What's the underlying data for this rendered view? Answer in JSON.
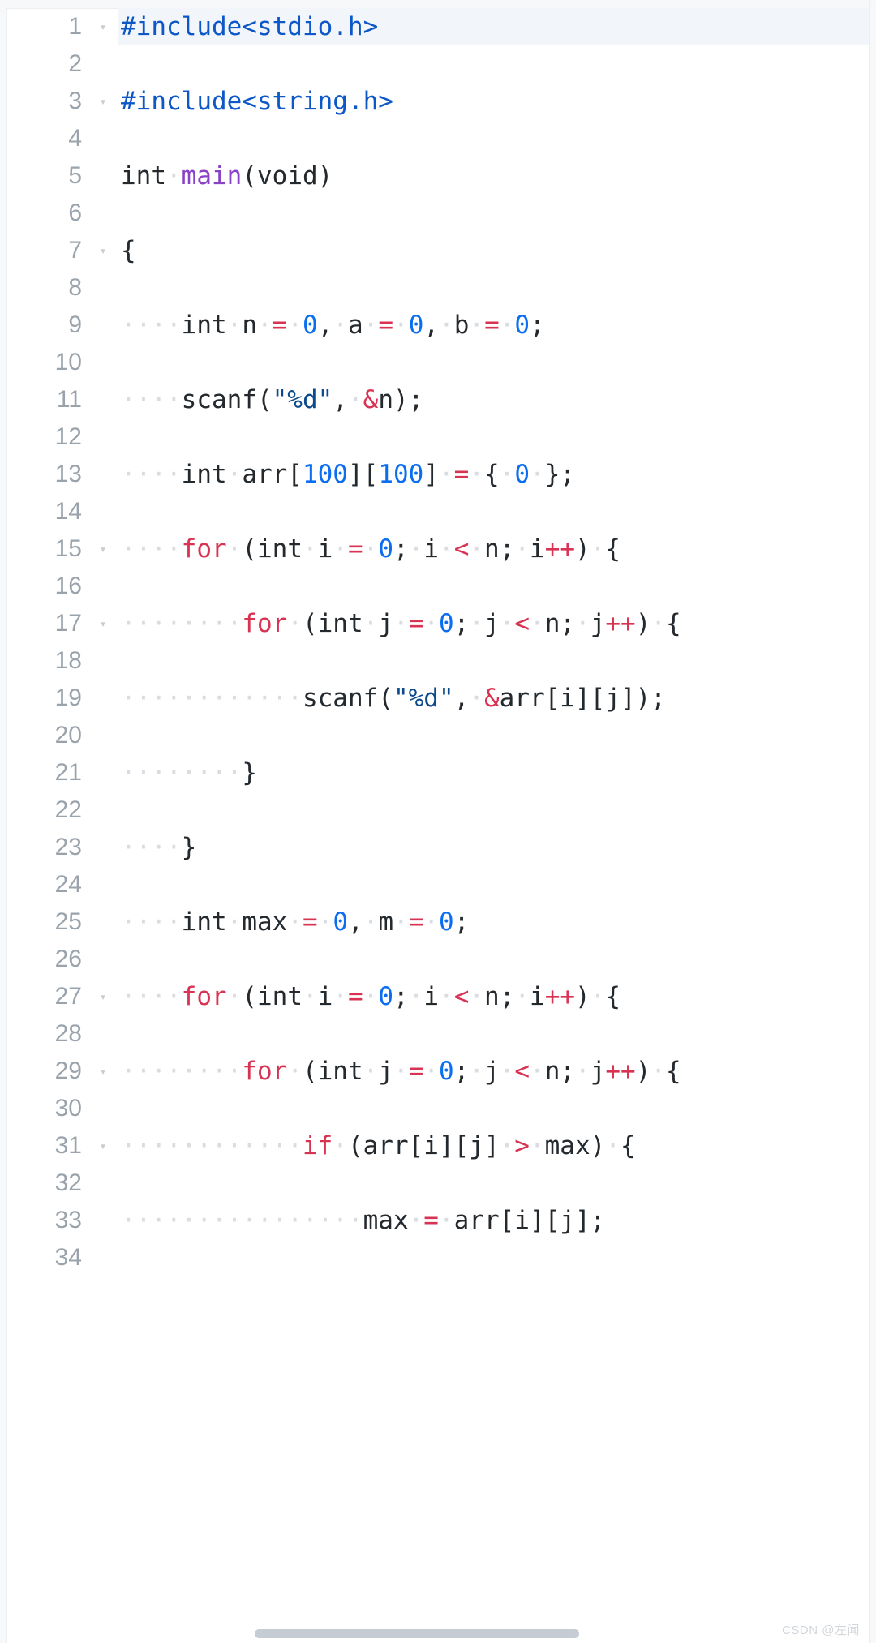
{
  "editor": {
    "language": "c",
    "indent_dot": "·",
    "fold_arrow": "▾",
    "colors": {
      "background": "#ffffff",
      "gutter_text": "#9aa3ab",
      "active_line_bg": "#f2f6fb",
      "preprocessor": "#0d58c6",
      "keyword": "#d93353",
      "function": "#8a42c8",
      "number": "#0b6ef0",
      "string": "#0d4a8c",
      "operator": "#d93353",
      "plain": "#24292e",
      "whitespace_dot": "#d9dde1",
      "scrollbar": "#c6ccd3"
    },
    "lines": [
      {
        "number": "1",
        "foldable": true,
        "highlight": true,
        "tokens": [
          {
            "t": "#include<stdio.h>",
            "c": "pre"
          }
        ]
      },
      {
        "number": "2",
        "foldable": false,
        "highlight": false,
        "tokens": []
      },
      {
        "number": "3",
        "foldable": true,
        "highlight": false,
        "tokens": [
          {
            "t": "#include<string.h>",
            "c": "pre"
          }
        ]
      },
      {
        "number": "4",
        "foldable": false,
        "highlight": false,
        "tokens": []
      },
      {
        "number": "5",
        "foldable": false,
        "highlight": false,
        "tokens": [
          {
            "t": "int",
            "c": "plain"
          },
          {
            "t": "·",
            "c": "ws"
          },
          {
            "t": "main",
            "c": "fn"
          },
          {
            "t": "(void)",
            "c": "plain"
          }
        ]
      },
      {
        "number": "6",
        "foldable": false,
        "highlight": false,
        "tokens": []
      },
      {
        "number": "7",
        "foldable": true,
        "highlight": false,
        "tokens": [
          {
            "t": "{",
            "c": "plain"
          }
        ]
      },
      {
        "number": "8",
        "foldable": false,
        "highlight": false,
        "tokens": []
      },
      {
        "number": "9",
        "foldable": false,
        "highlight": false,
        "tokens": [
          {
            "t": "····",
            "c": "ws"
          },
          {
            "t": "int",
            "c": "plain"
          },
          {
            "t": "·",
            "c": "ws"
          },
          {
            "t": "n",
            "c": "plain"
          },
          {
            "t": "·",
            "c": "ws"
          },
          {
            "t": "=",
            "c": "op"
          },
          {
            "t": "·",
            "c": "ws"
          },
          {
            "t": "0",
            "c": "num"
          },
          {
            "t": ",",
            "c": "plain"
          },
          {
            "t": "·",
            "c": "ws"
          },
          {
            "t": "a",
            "c": "plain"
          },
          {
            "t": "·",
            "c": "ws"
          },
          {
            "t": "=",
            "c": "op"
          },
          {
            "t": "·",
            "c": "ws"
          },
          {
            "t": "0",
            "c": "num"
          },
          {
            "t": ",",
            "c": "plain"
          },
          {
            "t": "·",
            "c": "ws"
          },
          {
            "t": "b",
            "c": "plain"
          },
          {
            "t": "·",
            "c": "ws"
          },
          {
            "t": "=",
            "c": "op"
          },
          {
            "t": "·",
            "c": "ws"
          },
          {
            "t": "0",
            "c": "num"
          },
          {
            "t": ";",
            "c": "plain"
          }
        ]
      },
      {
        "number": "10",
        "foldable": false,
        "highlight": false,
        "tokens": []
      },
      {
        "number": "11",
        "foldable": false,
        "highlight": false,
        "tokens": [
          {
            "t": "····",
            "c": "ws"
          },
          {
            "t": "scanf(",
            "c": "plain"
          },
          {
            "t": "\"%d\"",
            "c": "str"
          },
          {
            "t": ",",
            "c": "plain"
          },
          {
            "t": "·",
            "c": "ws"
          },
          {
            "t": "&",
            "c": "op"
          },
          {
            "t": "n);",
            "c": "plain"
          }
        ]
      },
      {
        "number": "12",
        "foldable": false,
        "highlight": false,
        "tokens": []
      },
      {
        "number": "13",
        "foldable": false,
        "highlight": false,
        "tokens": [
          {
            "t": "····",
            "c": "ws"
          },
          {
            "t": "int",
            "c": "plain"
          },
          {
            "t": "·",
            "c": "ws"
          },
          {
            "t": "arr[",
            "c": "plain"
          },
          {
            "t": "100",
            "c": "num"
          },
          {
            "t": "][",
            "c": "plain"
          },
          {
            "t": "100",
            "c": "num"
          },
          {
            "t": "]",
            "c": "plain"
          },
          {
            "t": "·",
            "c": "ws"
          },
          {
            "t": "=",
            "c": "op"
          },
          {
            "t": "·",
            "c": "ws"
          },
          {
            "t": "{",
            "c": "plain"
          },
          {
            "t": "·",
            "c": "ws"
          },
          {
            "t": "0",
            "c": "num"
          },
          {
            "t": "·",
            "c": "ws"
          },
          {
            "t": "};",
            "c": "plain"
          }
        ]
      },
      {
        "number": "14",
        "foldable": false,
        "highlight": false,
        "tokens": []
      },
      {
        "number": "15",
        "foldable": true,
        "highlight": false,
        "tokens": [
          {
            "t": "····",
            "c": "ws"
          },
          {
            "t": "for",
            "c": "kw"
          },
          {
            "t": "·",
            "c": "ws"
          },
          {
            "t": "(int",
            "c": "plain"
          },
          {
            "t": "·",
            "c": "ws"
          },
          {
            "t": "i",
            "c": "plain"
          },
          {
            "t": "·",
            "c": "ws"
          },
          {
            "t": "=",
            "c": "op"
          },
          {
            "t": "·",
            "c": "ws"
          },
          {
            "t": "0",
            "c": "num"
          },
          {
            "t": ";",
            "c": "plain"
          },
          {
            "t": "·",
            "c": "ws"
          },
          {
            "t": "i",
            "c": "plain"
          },
          {
            "t": "·",
            "c": "ws"
          },
          {
            "t": "<",
            "c": "op"
          },
          {
            "t": "·",
            "c": "ws"
          },
          {
            "t": "n;",
            "c": "plain"
          },
          {
            "t": "·",
            "c": "ws"
          },
          {
            "t": "i",
            "c": "plain"
          },
          {
            "t": "++",
            "c": "op"
          },
          {
            "t": ")",
            "c": "plain"
          },
          {
            "t": "·",
            "c": "ws"
          },
          {
            "t": "{",
            "c": "plain"
          }
        ]
      },
      {
        "number": "16",
        "foldable": false,
        "highlight": false,
        "tokens": []
      },
      {
        "number": "17",
        "foldable": true,
        "highlight": false,
        "tokens": [
          {
            "t": "········",
            "c": "ws"
          },
          {
            "t": "for",
            "c": "kw"
          },
          {
            "t": "·",
            "c": "ws"
          },
          {
            "t": "(int",
            "c": "plain"
          },
          {
            "t": "·",
            "c": "ws"
          },
          {
            "t": "j",
            "c": "plain"
          },
          {
            "t": "·",
            "c": "ws"
          },
          {
            "t": "=",
            "c": "op"
          },
          {
            "t": "·",
            "c": "ws"
          },
          {
            "t": "0",
            "c": "num"
          },
          {
            "t": ";",
            "c": "plain"
          },
          {
            "t": "·",
            "c": "ws"
          },
          {
            "t": "j",
            "c": "plain"
          },
          {
            "t": "·",
            "c": "ws"
          },
          {
            "t": "<",
            "c": "op"
          },
          {
            "t": "·",
            "c": "ws"
          },
          {
            "t": "n;",
            "c": "plain"
          },
          {
            "t": "·",
            "c": "ws"
          },
          {
            "t": "j",
            "c": "plain"
          },
          {
            "t": "++",
            "c": "op"
          },
          {
            "t": ")",
            "c": "plain"
          },
          {
            "t": "·",
            "c": "ws"
          },
          {
            "t": "{",
            "c": "plain"
          }
        ]
      },
      {
        "number": "18",
        "foldable": false,
        "highlight": false,
        "tokens": []
      },
      {
        "number": "19",
        "foldable": false,
        "highlight": false,
        "tokens": [
          {
            "t": "············",
            "c": "ws"
          },
          {
            "t": "scanf(",
            "c": "plain"
          },
          {
            "t": "\"%d\"",
            "c": "str"
          },
          {
            "t": ",",
            "c": "plain"
          },
          {
            "t": "·",
            "c": "ws"
          },
          {
            "t": "&",
            "c": "op"
          },
          {
            "t": "arr[i][j]);",
            "c": "plain"
          }
        ]
      },
      {
        "number": "20",
        "foldable": false,
        "highlight": false,
        "tokens": []
      },
      {
        "number": "21",
        "foldable": false,
        "highlight": false,
        "tokens": [
          {
            "t": "········",
            "c": "ws"
          },
          {
            "t": "}",
            "c": "plain"
          }
        ]
      },
      {
        "number": "22",
        "foldable": false,
        "highlight": false,
        "tokens": []
      },
      {
        "number": "23",
        "foldable": false,
        "highlight": false,
        "tokens": [
          {
            "t": "····",
            "c": "ws"
          },
          {
            "t": "}",
            "c": "plain"
          }
        ]
      },
      {
        "number": "24",
        "foldable": false,
        "highlight": false,
        "tokens": []
      },
      {
        "number": "25",
        "foldable": false,
        "highlight": false,
        "tokens": [
          {
            "t": "····",
            "c": "ws"
          },
          {
            "t": "int",
            "c": "plain"
          },
          {
            "t": "·",
            "c": "ws"
          },
          {
            "t": "max",
            "c": "plain"
          },
          {
            "t": "·",
            "c": "ws"
          },
          {
            "t": "=",
            "c": "op"
          },
          {
            "t": "·",
            "c": "ws"
          },
          {
            "t": "0",
            "c": "num"
          },
          {
            "t": ",",
            "c": "plain"
          },
          {
            "t": "·",
            "c": "ws"
          },
          {
            "t": "m",
            "c": "plain"
          },
          {
            "t": "·",
            "c": "ws"
          },
          {
            "t": "=",
            "c": "op"
          },
          {
            "t": "·",
            "c": "ws"
          },
          {
            "t": "0",
            "c": "num"
          },
          {
            "t": ";",
            "c": "plain"
          }
        ]
      },
      {
        "number": "26",
        "foldable": false,
        "highlight": false,
        "tokens": []
      },
      {
        "number": "27",
        "foldable": true,
        "highlight": false,
        "tokens": [
          {
            "t": "····",
            "c": "ws"
          },
          {
            "t": "for",
            "c": "kw"
          },
          {
            "t": "·",
            "c": "ws"
          },
          {
            "t": "(int",
            "c": "plain"
          },
          {
            "t": "·",
            "c": "ws"
          },
          {
            "t": "i",
            "c": "plain"
          },
          {
            "t": "·",
            "c": "ws"
          },
          {
            "t": "=",
            "c": "op"
          },
          {
            "t": "·",
            "c": "ws"
          },
          {
            "t": "0",
            "c": "num"
          },
          {
            "t": ";",
            "c": "plain"
          },
          {
            "t": "·",
            "c": "ws"
          },
          {
            "t": "i",
            "c": "plain"
          },
          {
            "t": "·",
            "c": "ws"
          },
          {
            "t": "<",
            "c": "op"
          },
          {
            "t": "·",
            "c": "ws"
          },
          {
            "t": "n;",
            "c": "plain"
          },
          {
            "t": "·",
            "c": "ws"
          },
          {
            "t": "i",
            "c": "plain"
          },
          {
            "t": "++",
            "c": "op"
          },
          {
            "t": ")",
            "c": "plain"
          },
          {
            "t": "·",
            "c": "ws"
          },
          {
            "t": "{",
            "c": "plain"
          }
        ]
      },
      {
        "number": "28",
        "foldable": false,
        "highlight": false,
        "tokens": []
      },
      {
        "number": "29",
        "foldable": true,
        "highlight": false,
        "tokens": [
          {
            "t": "········",
            "c": "ws"
          },
          {
            "t": "for",
            "c": "kw"
          },
          {
            "t": "·",
            "c": "ws"
          },
          {
            "t": "(int",
            "c": "plain"
          },
          {
            "t": "·",
            "c": "ws"
          },
          {
            "t": "j",
            "c": "plain"
          },
          {
            "t": "·",
            "c": "ws"
          },
          {
            "t": "=",
            "c": "op"
          },
          {
            "t": "·",
            "c": "ws"
          },
          {
            "t": "0",
            "c": "num"
          },
          {
            "t": ";",
            "c": "plain"
          },
          {
            "t": "·",
            "c": "ws"
          },
          {
            "t": "j",
            "c": "plain"
          },
          {
            "t": "·",
            "c": "ws"
          },
          {
            "t": "<",
            "c": "op"
          },
          {
            "t": "·",
            "c": "ws"
          },
          {
            "t": "n;",
            "c": "plain"
          },
          {
            "t": "·",
            "c": "ws"
          },
          {
            "t": "j",
            "c": "plain"
          },
          {
            "t": "++",
            "c": "op"
          },
          {
            "t": ")",
            "c": "plain"
          },
          {
            "t": "·",
            "c": "ws"
          },
          {
            "t": "{",
            "c": "plain"
          }
        ]
      },
      {
        "number": "30",
        "foldable": false,
        "highlight": false,
        "tokens": []
      },
      {
        "number": "31",
        "foldable": true,
        "highlight": false,
        "tokens": [
          {
            "t": "············",
            "c": "ws"
          },
          {
            "t": "if",
            "c": "kw"
          },
          {
            "t": "·",
            "c": "ws"
          },
          {
            "t": "(arr[i][j]",
            "c": "plain"
          },
          {
            "t": "·",
            "c": "ws"
          },
          {
            "t": ">",
            "c": "op"
          },
          {
            "t": "·",
            "c": "ws"
          },
          {
            "t": "max)",
            "c": "plain"
          },
          {
            "t": "·",
            "c": "ws"
          },
          {
            "t": "{",
            "c": "plain"
          }
        ]
      },
      {
        "number": "32",
        "foldable": false,
        "highlight": false,
        "tokens": []
      },
      {
        "number": "33",
        "foldable": false,
        "highlight": false,
        "tokens": [
          {
            "t": "················",
            "c": "ws"
          },
          {
            "t": "max",
            "c": "plain"
          },
          {
            "t": "·",
            "c": "ws"
          },
          {
            "t": "=",
            "c": "op"
          },
          {
            "t": "·",
            "c": "ws"
          },
          {
            "t": "arr[i][j];",
            "c": "plain"
          }
        ]
      },
      {
        "number": "34",
        "foldable": false,
        "highlight": false,
        "tokens": []
      }
    ]
  },
  "scrollbar": {
    "orientation": "horizontal"
  },
  "watermark": {
    "text": "CSDN @左闻"
  }
}
